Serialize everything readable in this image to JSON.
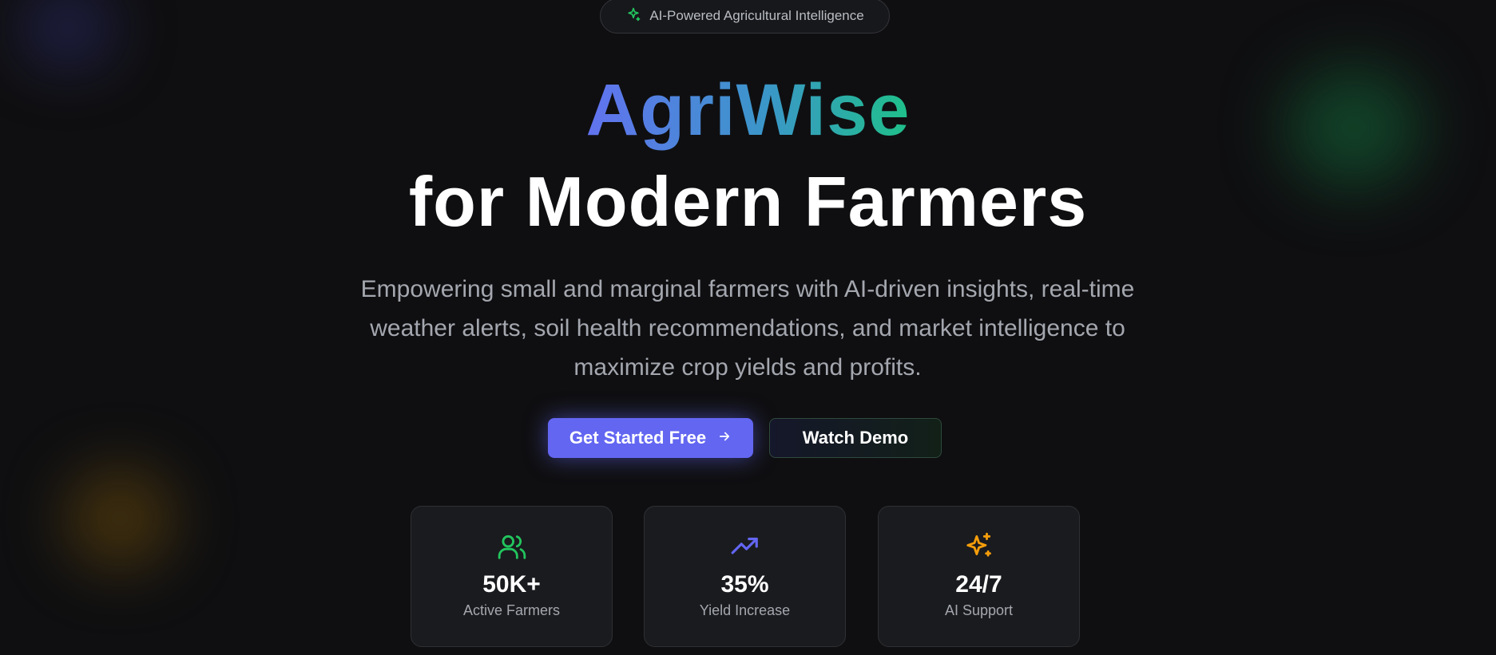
{
  "badge": {
    "text": "AI-Powered Agricultural Intelligence",
    "icon": "sparkle-icon"
  },
  "hero": {
    "brand": "AgriWise",
    "subtitle": "for Modern Farmers",
    "description": "Empowering small and marginal farmers with AI-driven insights, real-time weather alerts, soil health recommendations, and market intelligence to maximize crop yields and profits."
  },
  "buttons": {
    "primary_label": "Get Started Free",
    "primary_icon": "arrow-right-icon",
    "secondary_label": "Watch Demo"
  },
  "stats": [
    {
      "value": "50K+",
      "label": "Active Farmers",
      "icon": "users-icon",
      "color": "#22c55e"
    },
    {
      "value": "35%",
      "label": "Yield Increase",
      "icon": "trending-up-icon",
      "color": "#6366f1"
    },
    {
      "value": "24/7",
      "label": "AI Support",
      "icon": "sparkles-icon",
      "color": "#f59e0b"
    }
  ],
  "colors": {
    "accent": "#6366f1",
    "brand_gradient_start": "#6272f0",
    "brand_gradient_end": "#1fc08a",
    "background": "#0f0f11"
  }
}
